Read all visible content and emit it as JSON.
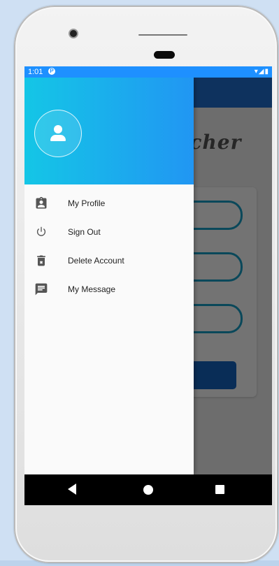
{
  "status_bar": {
    "time": "1:01",
    "notification_badge": "P",
    "icons": "▾◢▮"
  },
  "app_behind": {
    "title_partial": "ncher"
  },
  "drawer": {
    "avatar_icon": "person-icon",
    "menu": [
      {
        "label": "My Profile",
        "icon": "profile-badge-icon"
      },
      {
        "label": "Sign Out",
        "icon": "power-icon"
      },
      {
        "label": "Delete Account",
        "icon": "delete-icon"
      },
      {
        "label": "My Message",
        "icon": "message-icon"
      }
    ]
  },
  "colors": {
    "status_bar": "#1e90ff",
    "header_gradient_start": "#14c6e6",
    "header_gradient_end": "#2196f3",
    "app_bar": "#1f6fd0",
    "field_border": "#18a0c8"
  }
}
